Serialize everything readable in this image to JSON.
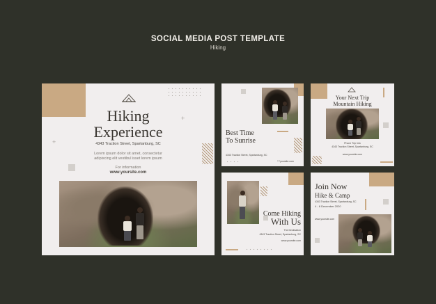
{
  "header": {
    "title": "SOCIAL MEDIA POST TEMPLATE",
    "subtitle": "Hiking"
  },
  "colors": {
    "background": "#2f3129",
    "card": "#f1eeee",
    "accent_tan": "#c9a983",
    "text_dark": "#3a3631"
  },
  "post1": {
    "title_line1": "Hiking",
    "title_line2": "Experience",
    "address": "4343  Traction Street, Spartanburg, SC",
    "body_line1": "Lorem ipsum dolor sit amet, consectetur",
    "body_line2": "adipiscing elit vestibul isset lorem ipsum",
    "info_label": "For information",
    "website": "www.yoursite.com"
  },
  "post2": {
    "title_line1": "Best Time",
    "title_line2": "To Sunrise",
    "address": "4343 Traction Street, Spartanburg, SC",
    "website": "***yoursite.com"
  },
  "post3": {
    "title_line1": "Your Next Trip",
    "title_line2": "Mountain Hiking",
    "info_label": "Phone Trip Info",
    "address": "4343 Traction Street, Spartanburg, SC",
    "website": "www.yoursite.com"
  },
  "post4": {
    "title_line1": "Come Hiking",
    "title_line2": "With Us",
    "info_label": "The Destination",
    "address": "4343 Traction Street, Spartanburg, SC",
    "website": "www.yoursite.com"
  },
  "post5": {
    "title_line1": "Join Now",
    "title_line2": "Hike & Camp",
    "address": "4343 Traction Street, Spartanburg, SC",
    "dates": "4 - 6 December 2020",
    "website": "www.yoursite.com"
  }
}
